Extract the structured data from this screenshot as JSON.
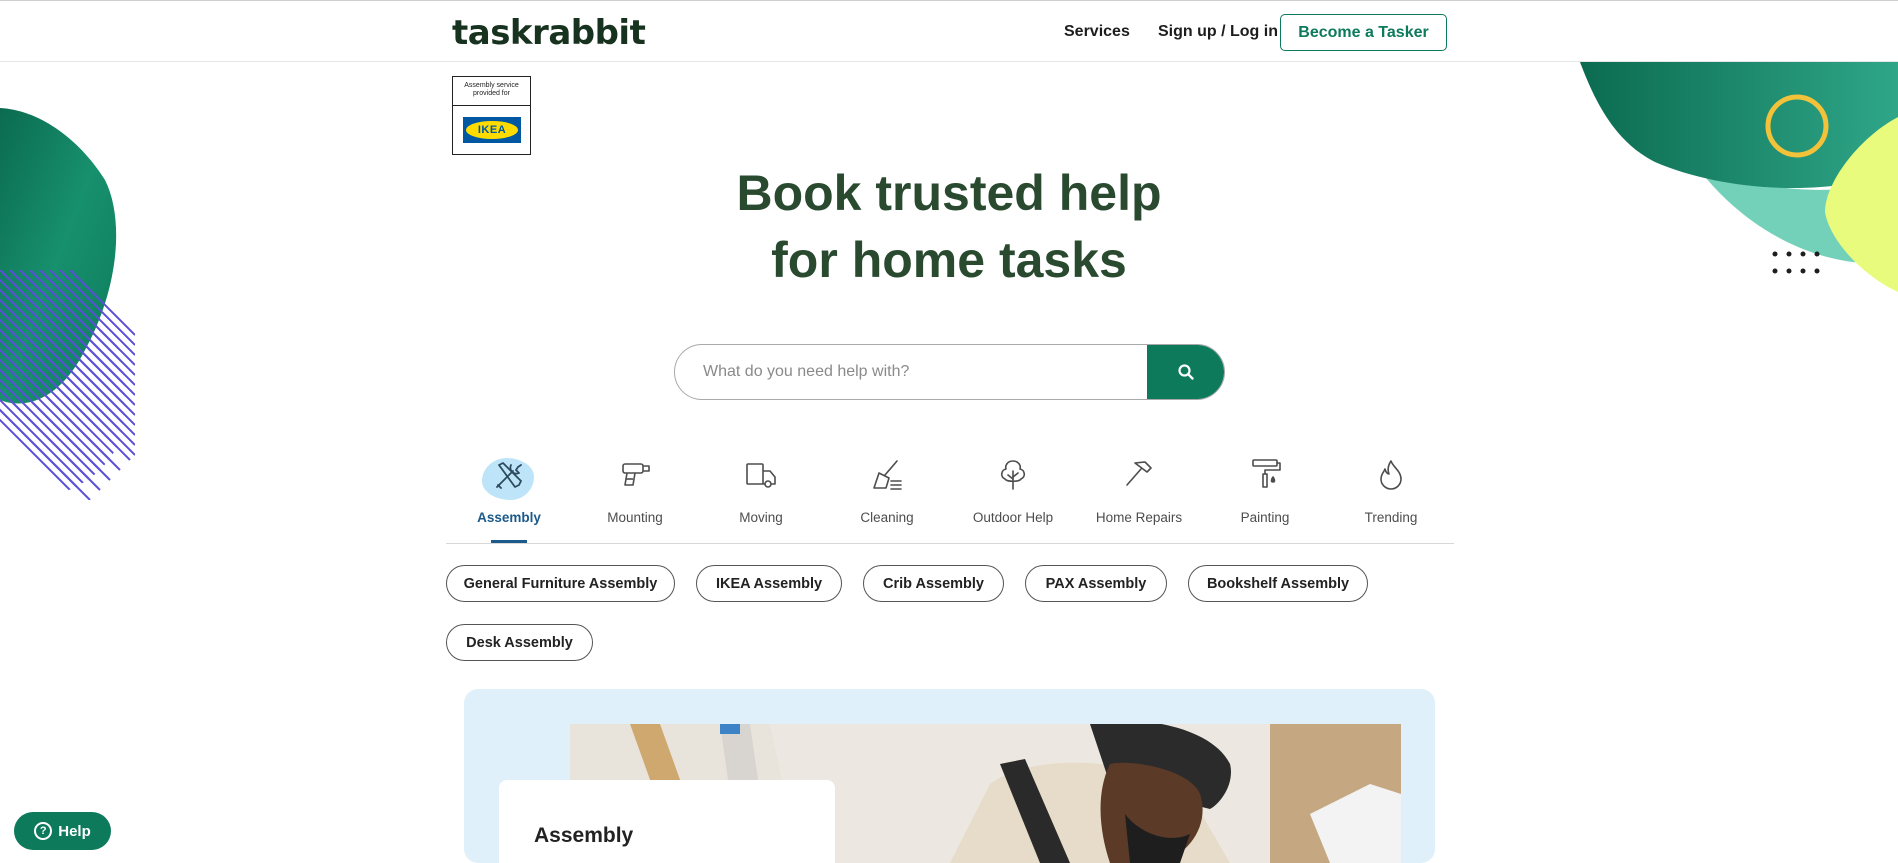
{
  "header": {
    "logo": "taskrabbit",
    "nav_services": "Services",
    "nav_auth": "Sign up / Log in",
    "become_tasker": "Become a Tasker"
  },
  "ikea_badge": {
    "caption": "Assembly service provided for",
    "logo_text": "IKEA"
  },
  "hero": {
    "line1": "Book trusted help",
    "line2": "for home tasks"
  },
  "search": {
    "placeholder": "What do you need help with?",
    "icon": "search-icon"
  },
  "categories": [
    {
      "label": "Assembly",
      "icon": "tools-icon",
      "active": true
    },
    {
      "label": "Mounting",
      "icon": "drill-icon",
      "active": false
    },
    {
      "label": "Moving",
      "icon": "truck-icon",
      "active": false
    },
    {
      "label": "Cleaning",
      "icon": "broom-icon",
      "active": false
    },
    {
      "label": "Outdoor Help",
      "icon": "tree-icon",
      "active": false
    },
    {
      "label": "Home Repairs",
      "icon": "hammer-icon",
      "active": false
    },
    {
      "label": "Painting",
      "icon": "paint-roller-icon",
      "active": false
    },
    {
      "label": "Trending",
      "icon": "flame-icon",
      "active": false
    }
  ],
  "chips": [
    "General Furniture Assembly",
    "IKEA Assembly",
    "Crib Assembly",
    "PAX Assembly",
    "Bookshelf Assembly",
    "Desk Assembly"
  ],
  "feature": {
    "title": "Assembly"
  },
  "help": {
    "label": "Help",
    "icon": "question-icon"
  },
  "colors": {
    "brand_green": "#0d7a5c",
    "hero_text": "#2a4a30",
    "active_blue": "#1b5a8a",
    "feature_bg": "#dff0fb"
  }
}
